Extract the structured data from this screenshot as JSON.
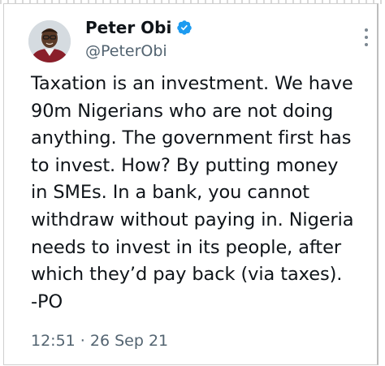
{
  "tweet": {
    "author": {
      "display_name": "Peter Obi",
      "handle": "@PeterObi",
      "verified": true
    },
    "text_lines": [
      "Taxation is an investment. We have",
      "90m Nigerians who are not doing",
      "anything. The government first has",
      "to invest. How? By putting money",
      "in SMEs. In a bank, you cannot",
      "withdraw without paying in. Nigeria",
      "needs to invest in its people, after",
      "which they’d pay back (via taxes).",
      "-PO"
    ],
    "timestamp": "12:51 · 26 Sep 21"
  },
  "colors": {
    "text_primary": "#0f1419",
    "text_secondary": "#536471",
    "verified_badge": "#1d9bf0"
  },
  "icons": {
    "verified": "verified-badge-icon",
    "more": "more-options-icon"
  }
}
